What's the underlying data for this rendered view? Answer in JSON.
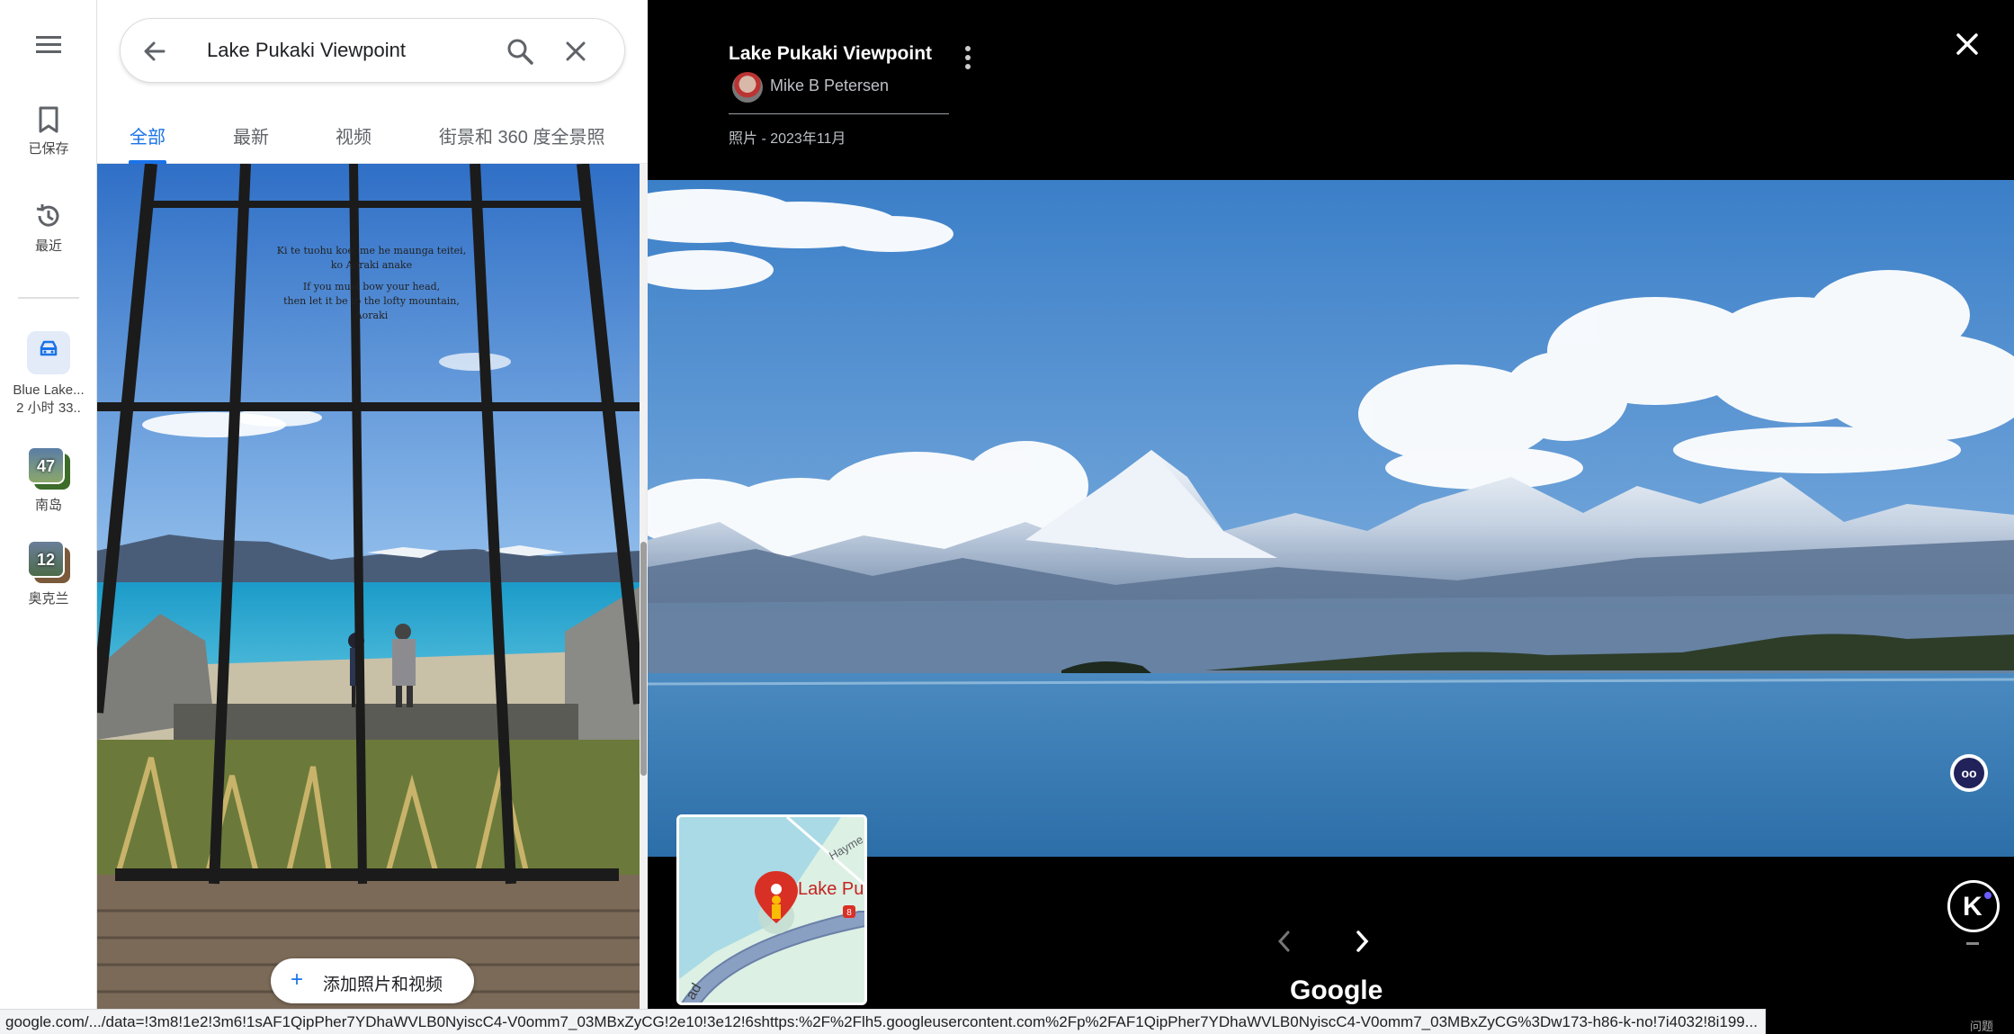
{
  "rail": {
    "menu_icon": "menu-icon",
    "saved_label": "已保存",
    "recent_label": "最近",
    "recent_items": [
      {
        "label": "Blue Lake...",
        "sublabel": "2 小时 33..",
        "icon": "car-icon"
      },
      {
        "label": "南岛",
        "count": "47"
      },
      {
        "label": "奥克兰",
        "count": "12"
      }
    ]
  },
  "search": {
    "value": "Lake Pukaki Viewpoint"
  },
  "tabs": [
    {
      "label": "全部",
      "active": true
    },
    {
      "label": "最新",
      "active": false
    },
    {
      "label": "视频",
      "active": false
    },
    {
      "label": "街景和 360 度全景照",
      "active": false
    }
  ],
  "photo_tile": {
    "inscription": [
      "Ki te tuohu koe, me he maunga teitei,",
      "ko Aoraki anake",
      "If you must bow your head,",
      "then let it be to the lofty mountain,",
      "Aoraki"
    ]
  },
  "add_photo_label": "添加照片和视频",
  "viewer": {
    "title": "Lake Pukaki Viewpoint",
    "author": "Mike B Petersen",
    "meta": "照片 - 2023年11月",
    "minimap_label": "Lake Puk",
    "minimap_road": "Hayme",
    "minimap_road_bottom": "ad",
    "minimap_shield": "8",
    "google_logo": "Google",
    "ext_k": "K",
    "ext_eyes": "oo",
    "help": "问题"
  },
  "status_url": "google.com/.../data=!3m8!1e2!3m6!1sAF1QipPher7YDhaWVLB0NyiscC4-V0omm7_03MBxZyCG!2e10!3e12!6shttps:%2F%2Flh5.googleusercontent.com%2Fp%2FAF1QipPher7YDhaWVLB0NyiscC4-V0omm7_03MBxZyCG%3Dw173-h86-k-no!7i4032!8i199..."
}
